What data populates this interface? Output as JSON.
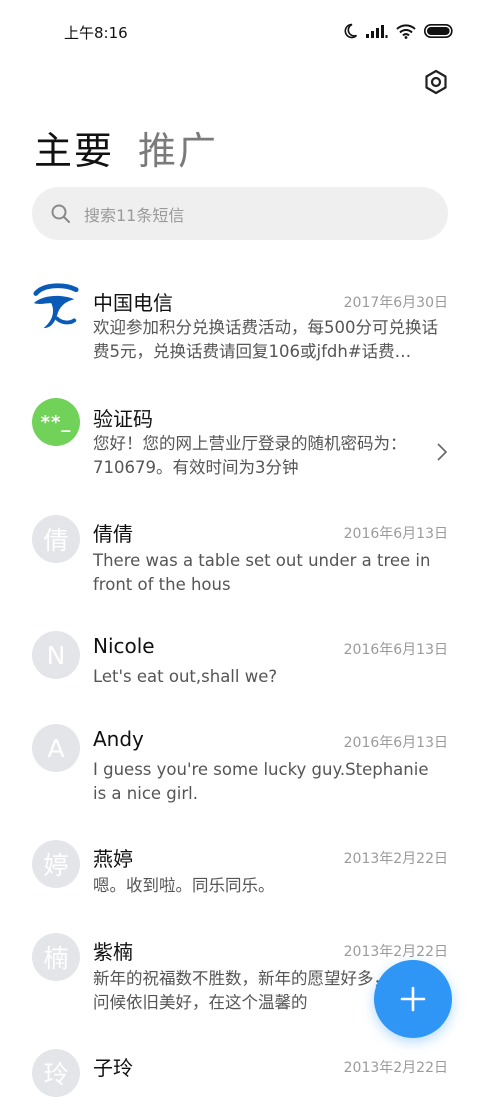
{
  "status_bar": {
    "time": "上午8:16"
  },
  "tabs": [
    {
      "label": "主要"
    },
    {
      "label": "推广"
    }
  ],
  "search": {
    "placeholder": "搜索11条短信"
  },
  "conversations": [
    {
      "name": "中国电信",
      "date": "2017年6月30日",
      "avatar_icon": "china-telecom-logo",
      "preview": "欢迎参加积分兑换话费活动，每500分可兑换话费5元，兑换话费请回复106或jfdh#话费…"
    },
    {
      "name": "验证码",
      "date": "",
      "avatar_text": "**_",
      "preview": "您好！您的网上营业厅登录的随机密码为：710679。有效时间为3分钟"
    },
    {
      "name": "倩倩",
      "date": "2016年6月13日",
      "avatar_text": "倩",
      "preview": "There was a table set out under a tree in front of the hous"
    },
    {
      "name": "Nicole",
      "date": "2016年6月13日",
      "avatar_text": "N",
      "preview": "Let's eat out,shall we?"
    },
    {
      "name": "Andy",
      "date": "2016年6月13日",
      "avatar_text": "A",
      "preview": "I guess you're some lucky guy.Stephanie is a nice girl."
    },
    {
      "name": "燕婷",
      "date": "2013年2月22日",
      "avatar_text": "婷",
      "preview": "嗯。收到啦。同乐同乐。"
    },
    {
      "name": "紫楠",
      "date": "2013年2月22日",
      "avatar_text": "楠",
      "preview": "新年的祝福数不胜数，新年的愿望好多，新年的问候依旧美好，在这个温馨的"
    },
    {
      "name": "子玲",
      "date": "2013年2月22日",
      "avatar_text": "玲",
      "preview": ""
    }
  ],
  "colors": {
    "accent": "#2f96f5",
    "green_avatar": "#71d25a",
    "telecom_blue": "#0a5bb8"
  }
}
